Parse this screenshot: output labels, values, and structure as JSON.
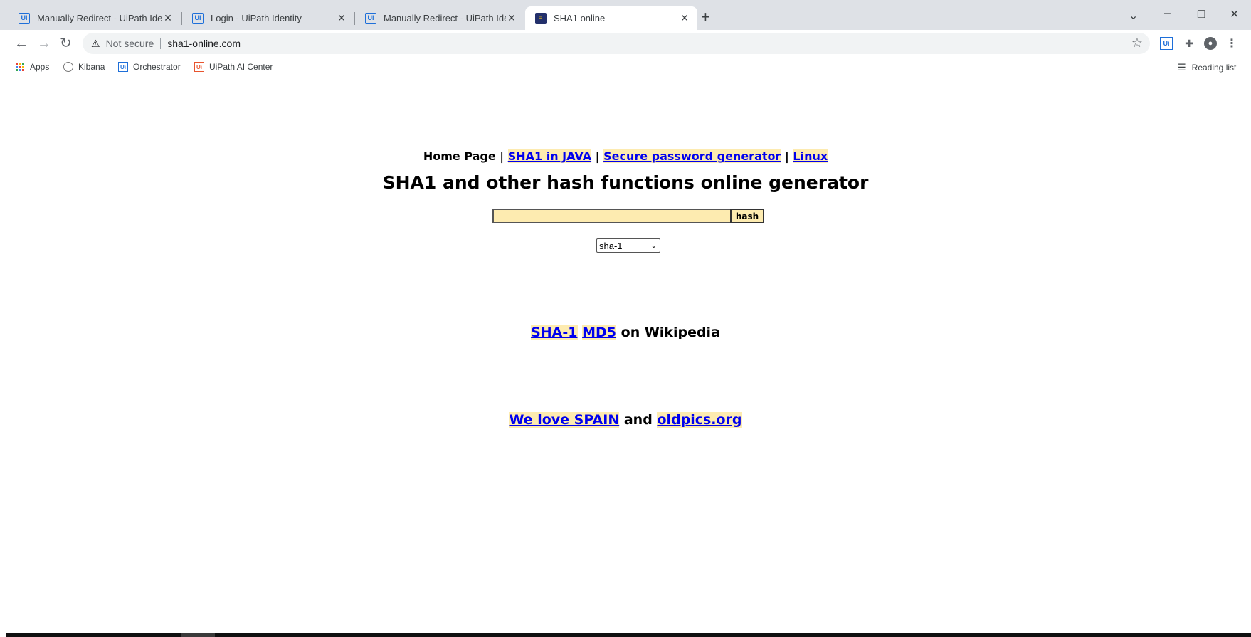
{
  "browser": {
    "tabs": [
      {
        "title": "Manually Redirect - UiPath Identi",
        "favicon": "uipath-icon",
        "active": false
      },
      {
        "title": "Login - UiPath Identity",
        "favicon": "uipath-icon",
        "active": false
      },
      {
        "title": "Manually Redirect - UiPath Identi",
        "favicon": "uipath-icon",
        "active": false
      },
      {
        "title": "SHA1 online",
        "favicon": "sha1-online-icon",
        "active": true
      }
    ],
    "favicon_text": "Ui",
    "address": {
      "security_label": "Not secure",
      "url": "sha1-online.com"
    },
    "bookmarks": [
      {
        "label": "Apps",
        "icon": "apps-grid-icon"
      },
      {
        "label": "Kibana",
        "icon": "kibana-icon"
      },
      {
        "label": "Orchestrator",
        "icon": "uipath-icon"
      },
      {
        "label": "UiPath AI Center",
        "icon": "uipath-ai-icon"
      }
    ],
    "reading_list": "Reading list"
  },
  "page": {
    "nav": {
      "home": "Home Page",
      "separator": "|",
      "links": [
        "SHA1 in JAVA",
        "Secure password generator",
        "Linux"
      ]
    },
    "headline": "SHA1 and other hash functions online generator",
    "input": {
      "value": "",
      "placeholder": ""
    },
    "hash_button": "hash",
    "algorithm": {
      "selected": "sha-1"
    },
    "wiki": {
      "link1": "SHA-1",
      "link2": "MD5",
      "suffix": "on Wikipedia"
    },
    "promo": {
      "link1": "We love SPAIN",
      "conjunction": "and",
      "link2": "oldpics.org"
    }
  },
  "colors": {
    "link": "#0000ee",
    "highlight": "#fdebb0",
    "tabstrip": "#dee1e6"
  }
}
